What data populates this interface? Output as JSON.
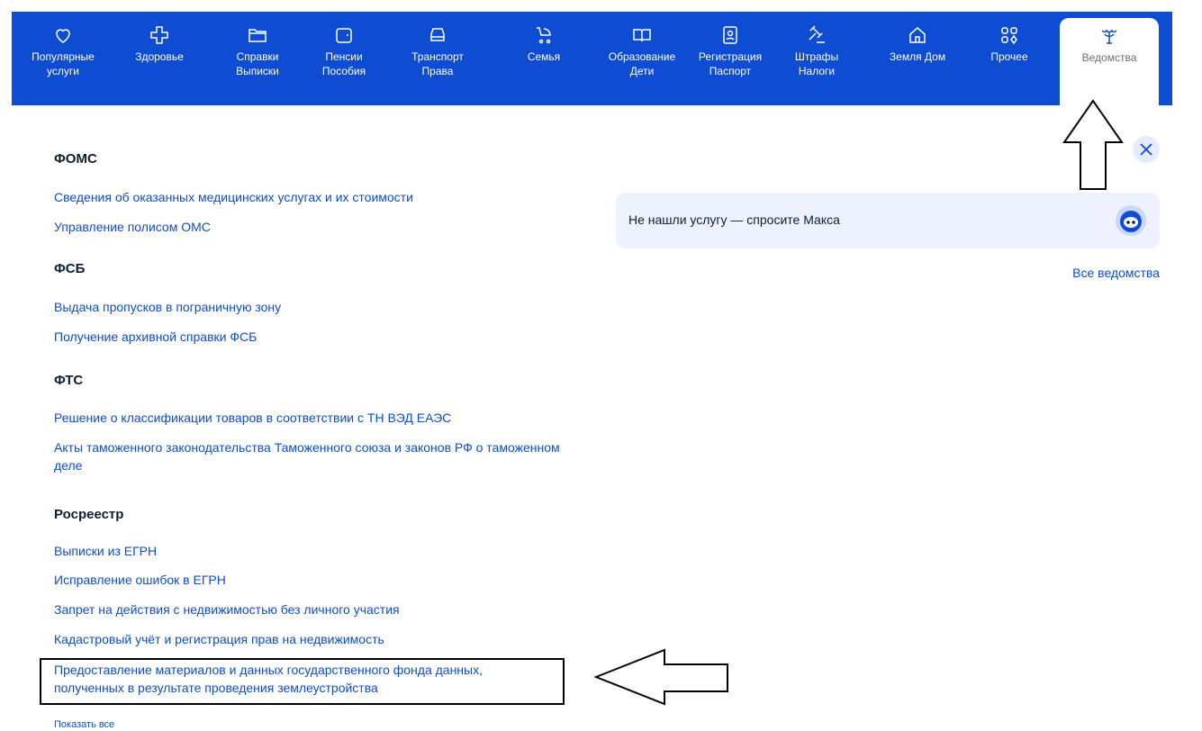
{
  "nav": {
    "items": [
      {
        "label": "Популярные\nуслуги",
        "icon": "heart-icon"
      },
      {
        "label": "Здоровье",
        "icon": "cross-icon"
      },
      {
        "label": "Справки\nВыписки",
        "icon": "folder-icon"
      },
      {
        "label": "Пенсии\nПособия",
        "icon": "wallet-icon"
      },
      {
        "label": "Транспорт\nПрава",
        "icon": "car-icon"
      },
      {
        "label": "Семья",
        "icon": "stroller-icon"
      },
      {
        "label": "Образование\nДети",
        "icon": "book-icon"
      },
      {
        "label": "Регистрация\nПаспорт",
        "icon": "passport-icon"
      },
      {
        "label": "Штрафы\nНалоги",
        "icon": "gavel-icon"
      },
      {
        "label": "Земля Дом",
        "icon": "house-icon"
      },
      {
        "label": "Прочее",
        "icon": "grid-icon"
      },
      {
        "label": "Ведомства",
        "icon": "emblem-icon"
      }
    ]
  },
  "sections": [
    {
      "title": "ФОМС",
      "links": [
        "Сведения об оказанных медицинских услугах и их стоимости",
        "Управление полисом ОМС"
      ]
    },
    {
      "title": "ФСБ",
      "links": [
        "Выдача пропусков в пограничную зону",
        "Получение архивной справки ФСБ"
      ]
    },
    {
      "title": "ФТС",
      "links": [
        "Решение о классификации товаров в соответствии с ТН ВЭД ЕАЭС",
        "Акты таможенного законодательства Таможенного союза и законов РФ о таможенном деле"
      ]
    },
    {
      "title": "Росреестр",
      "links": [
        "Выписки из ЕГРН",
        "Исправление ошибок в ЕГРН",
        "Запрет на действия с недвижимостью без личного участия",
        "Кадастровый учёт и регистрация прав на недвижимость",
        "Предоставление материалов и данных государственного фонда данных, полученных в результате проведения землеустройства"
      ]
    }
  ],
  "show_all": "Показать все",
  "assistant": {
    "prompt": "Не нашли услугу — спросите Макса"
  },
  "all_agencies": "Все ведомства",
  "colors": {
    "brand": "#0d4cd3",
    "panel": "#edf2fe"
  }
}
